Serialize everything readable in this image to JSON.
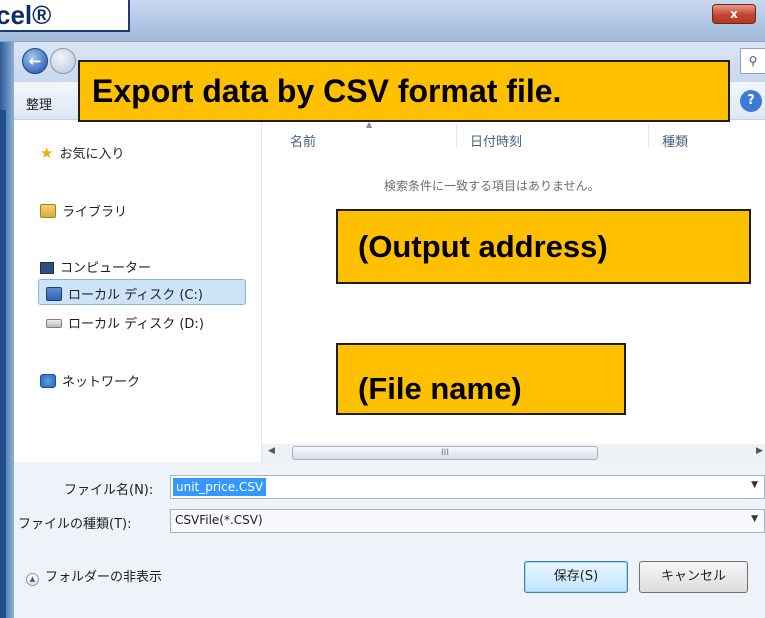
{
  "window": {
    "close_symbol": "x",
    "app_label": "cel®"
  },
  "annotations": {
    "title": "Export data by CSV format file.",
    "output_address": "(Output address)",
    "file_name": "(File name)"
  },
  "toolbar": {
    "organize_label": "整理"
  },
  "sidebar": {
    "items": [
      {
        "label": "お気に入り",
        "icon": "star-icon"
      },
      {
        "label": "ライブラリ",
        "icon": "library-icon"
      },
      {
        "label": "コンピューター",
        "icon": "computer-icon"
      },
      {
        "label": "ローカル ディスク (C:)",
        "icon": "local-disk-icon"
      },
      {
        "label": "ローカル ディスク (D:)",
        "icon": "local-disk-icon"
      },
      {
        "label": "ネットワーク",
        "icon": "network-icon"
      }
    ]
  },
  "file_list": {
    "columns": [
      "名前",
      "日付時刻",
      "種類"
    ],
    "empty_message": "検索条件に一致する項目はありません。"
  },
  "scrollbar": {
    "grip": "III"
  },
  "form": {
    "filename_label": "ファイル名(N):",
    "filename_value": "unit_price.CSV",
    "filetype_label": "ファイルの種類(T):",
    "filetype_value": "CSVFile(*.CSV)"
  },
  "footer": {
    "hide_folders_label": "フォルダーの非表示",
    "save_label": "保存(S)",
    "cancel_label": "キャンセル"
  }
}
